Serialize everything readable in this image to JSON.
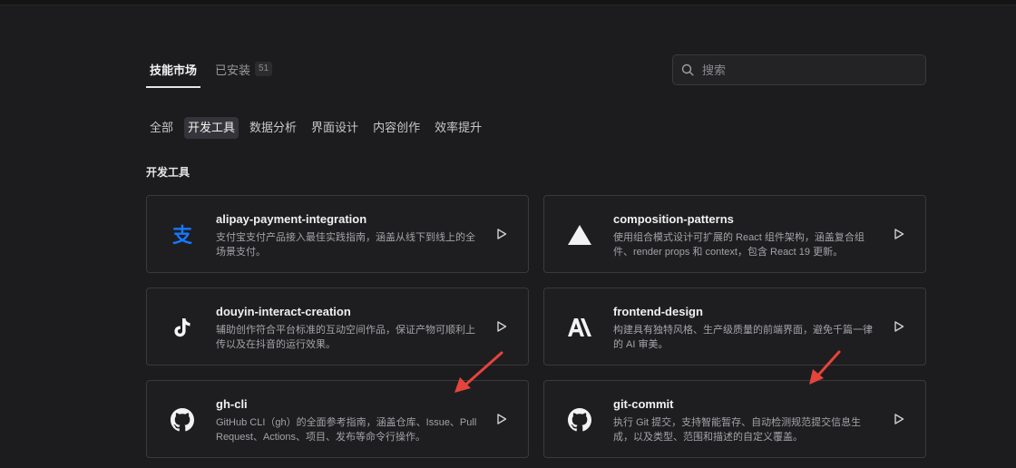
{
  "tabs": [
    {
      "label": "技能市场",
      "active": true
    },
    {
      "label": "已安装",
      "count": "51",
      "active": false
    }
  ],
  "search": {
    "placeholder": "搜索"
  },
  "filters": [
    {
      "label": "全部",
      "active": false
    },
    {
      "label": "开发工具",
      "active": true
    },
    {
      "label": "数据分析",
      "active": false
    },
    {
      "label": "界面设计",
      "active": false
    },
    {
      "label": "内容创作",
      "active": false
    },
    {
      "label": "效率提升",
      "active": false
    }
  ],
  "section": {
    "title": "开发工具"
  },
  "cards": [
    {
      "name": "alipay-payment-integration",
      "desc": "支付宝支付产品接入最佳实践指南，涵盖从线下到线上的全场景支付。",
      "icon": "alipay-icon"
    },
    {
      "name": "composition-patterns",
      "desc": "使用组合模式设计可扩展的 React 组件架构，涵盖复合组件、render props 和 context，包含 React 19 更新。",
      "icon": "triangle-icon"
    },
    {
      "name": "douyin-interact-creation",
      "desc": "辅助创作符合平台标准的互动空间作品，保证产物可顺利上传以及在抖音的运行效果。",
      "icon": "tiktok-icon"
    },
    {
      "name": "frontend-design",
      "desc": "构建具有独特风格、生产级质量的前端界面，避免千篇一律的 AI 审美。",
      "icon": "anthropic-icon"
    },
    {
      "name": "gh-cli",
      "desc": "GitHub CLI（gh）的全面参考指南，涵盖仓库、Issue、Pull Request、Actions、项目、发布等命令行操作。",
      "icon": "github-icon"
    },
    {
      "name": "git-commit",
      "desc": "执行 Git 提交，支持智能暂存、自动检测规范提交信息生成，以及类型、范围和描述的自定义覆盖。",
      "icon": "github-icon"
    }
  ],
  "colors": {
    "background": "#1c1c1e",
    "card_border": "#3a3a3d",
    "alipay_blue": "#1677ff",
    "annotation_red": "#e5443b"
  }
}
